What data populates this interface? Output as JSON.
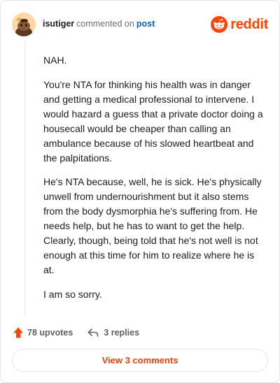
{
  "header": {
    "username": "isutiger",
    "action_text": "commented on",
    "post_link": "post",
    "brand": "reddit"
  },
  "comment": {
    "paragraphs": [
      "NAH.",
      "You're NTA for thinking his health was in danger and getting a medical professional to intervene. I would hazard a guess that a private doctor doing a housecall would be cheaper than calling an ambulance because of his slowed heartbeat and the palpitations.",
      "He's NTA because, well, he is sick. He's physically unwell from undernourishment but it also stems from the body dysmorphia he's suffering from. He needs help, but he has to want to get the help. Clearly, though, being told that he's not well is not enough at this time for him to realize where he is at.",
      "I am so sorry."
    ]
  },
  "actions": {
    "upvotes": "78 upvotes",
    "replies": "3 replies",
    "view_comments": "View 3 comments"
  },
  "colors": {
    "brand": "#ff4500",
    "link": "#0c61b8",
    "view_button_text": "#e0430a"
  },
  "icons": {
    "avatar": "snoo-avatar",
    "brand": "reddit-logo-icon",
    "upvote": "upvote-arrow-icon",
    "reply": "reply-arrow-icon"
  }
}
